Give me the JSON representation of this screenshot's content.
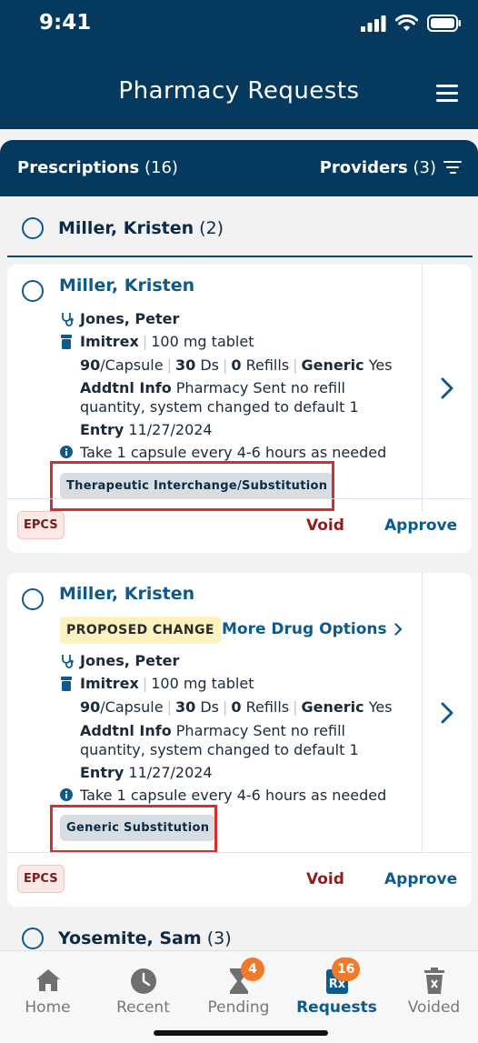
{
  "status": {
    "time": "9:41"
  },
  "header": {
    "title": "Pharmacy Requests"
  },
  "filter": {
    "prescriptions_label": "Prescriptions",
    "prescriptions_count": "(16)",
    "providers_label": "Providers",
    "providers_count": "(3)"
  },
  "groups": [
    {
      "name": "Miller, Kristen",
      "count": "(2)"
    },
    {
      "name": "Yosemite, Sam",
      "count": "(3)"
    }
  ],
  "cards": [
    {
      "patient": "Miller, Kristen",
      "provider": "Jones, Peter",
      "drug": "Imitrex",
      "strength": "100 mg tablet",
      "qty": "90",
      "form": "/Capsule",
      "days": "30",
      "days_label": "Ds",
      "refills": "0",
      "refills_label": "Refills",
      "generic_label": "Generic",
      "generic_value": "Yes",
      "addtl_label": "Addtnl Info",
      "addtl_text_1": "Pharmacy Sent no refill",
      "addtl_text_2": "quantity, system changed to default 1",
      "entry_label": "Entry",
      "entry_date": "11/27/2024",
      "sig": "Take 1 capsule every 4-6 hours as needed",
      "tag": "Therapeutic Interchange/Substitution",
      "epcs": "EPCS",
      "void": "Void",
      "approve": "Approve"
    },
    {
      "patient": "Miller, Kristen",
      "proposed": "PROPOSED CHANGE",
      "more_options": "More Drug Options",
      "provider": "Jones, Peter",
      "drug": "Imitrex",
      "strength": "100 mg tablet",
      "qty": "90",
      "form": "/Capsule",
      "days": "30",
      "days_label": "Ds",
      "refills": "0",
      "refills_label": "Refills",
      "generic_label": "Generic",
      "generic_value": "Yes",
      "addtl_label": "Addtnl Info",
      "addtl_text_1": "Pharmacy Sent no refill",
      "addtl_text_2": "quantity, system changed to default 1",
      "entry_label": "Entry",
      "entry_date": "11/27/2024",
      "sig": "Take 1 capsule every 4-6 hours as needed",
      "tag": "Generic Substitution",
      "epcs": "EPCS",
      "void": "Void",
      "approve": "Approve"
    }
  ],
  "tabs": [
    {
      "label": "Home",
      "icon": "home-icon"
    },
    {
      "label": "Recent",
      "icon": "clock-icon"
    },
    {
      "label": "Pending",
      "icon": "hourglass-icon",
      "badge": "4"
    },
    {
      "label": "Requests",
      "icon": "rx-icon",
      "badge": "16",
      "active": true
    },
    {
      "label": "Voided",
      "icon": "trash-icon"
    }
  ],
  "colors": {
    "primary": "#053a5e",
    "accent": "#0d5a8c",
    "badge": "#f07a2a",
    "void": "#8b1e1e",
    "highlight": "#d32f2f"
  }
}
